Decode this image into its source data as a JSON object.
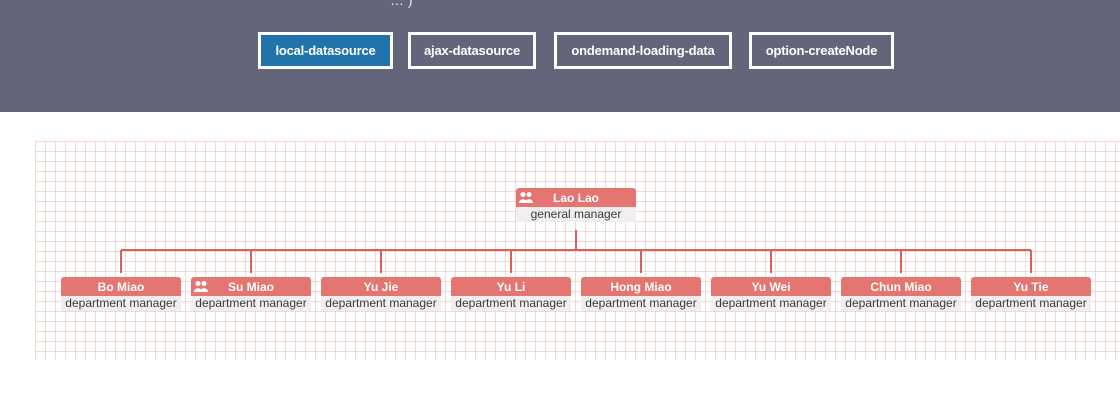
{
  "header": {
    "cut_text": "… )",
    "buttons": [
      {
        "label": "local-datasource",
        "active": true
      },
      {
        "label": "ajax-datasource",
        "active": false
      },
      {
        "label": "ondemand-loading-data",
        "active": false
      },
      {
        "label": "option-createNode",
        "active": false
      }
    ]
  },
  "org_chart": {
    "root": {
      "name": "Lao Lao",
      "title": "general manager",
      "icon": "users-icon"
    },
    "children": [
      {
        "name": "Bo Miao",
        "title": "department manager",
        "icon": ""
      },
      {
        "name": "Su Miao",
        "title": "department manager",
        "icon": "users-icon"
      },
      {
        "name": "Yu Jie",
        "title": "department manager",
        "icon": ""
      },
      {
        "name": "Yu Li",
        "title": "department manager",
        "icon": ""
      },
      {
        "name": "Hong Miao",
        "title": "department manager",
        "icon": ""
      },
      {
        "name": "Yu Wei",
        "title": "department manager",
        "icon": ""
      },
      {
        "name": "Chun Miao",
        "title": "department manager",
        "icon": ""
      },
      {
        "name": "Yu Tie",
        "title": "department manager",
        "icon": ""
      }
    ]
  },
  "colors": {
    "header_bg": "#63667b",
    "active_button": "#2173ab",
    "node_title": "#e47570",
    "connector": "#d6605c"
  }
}
